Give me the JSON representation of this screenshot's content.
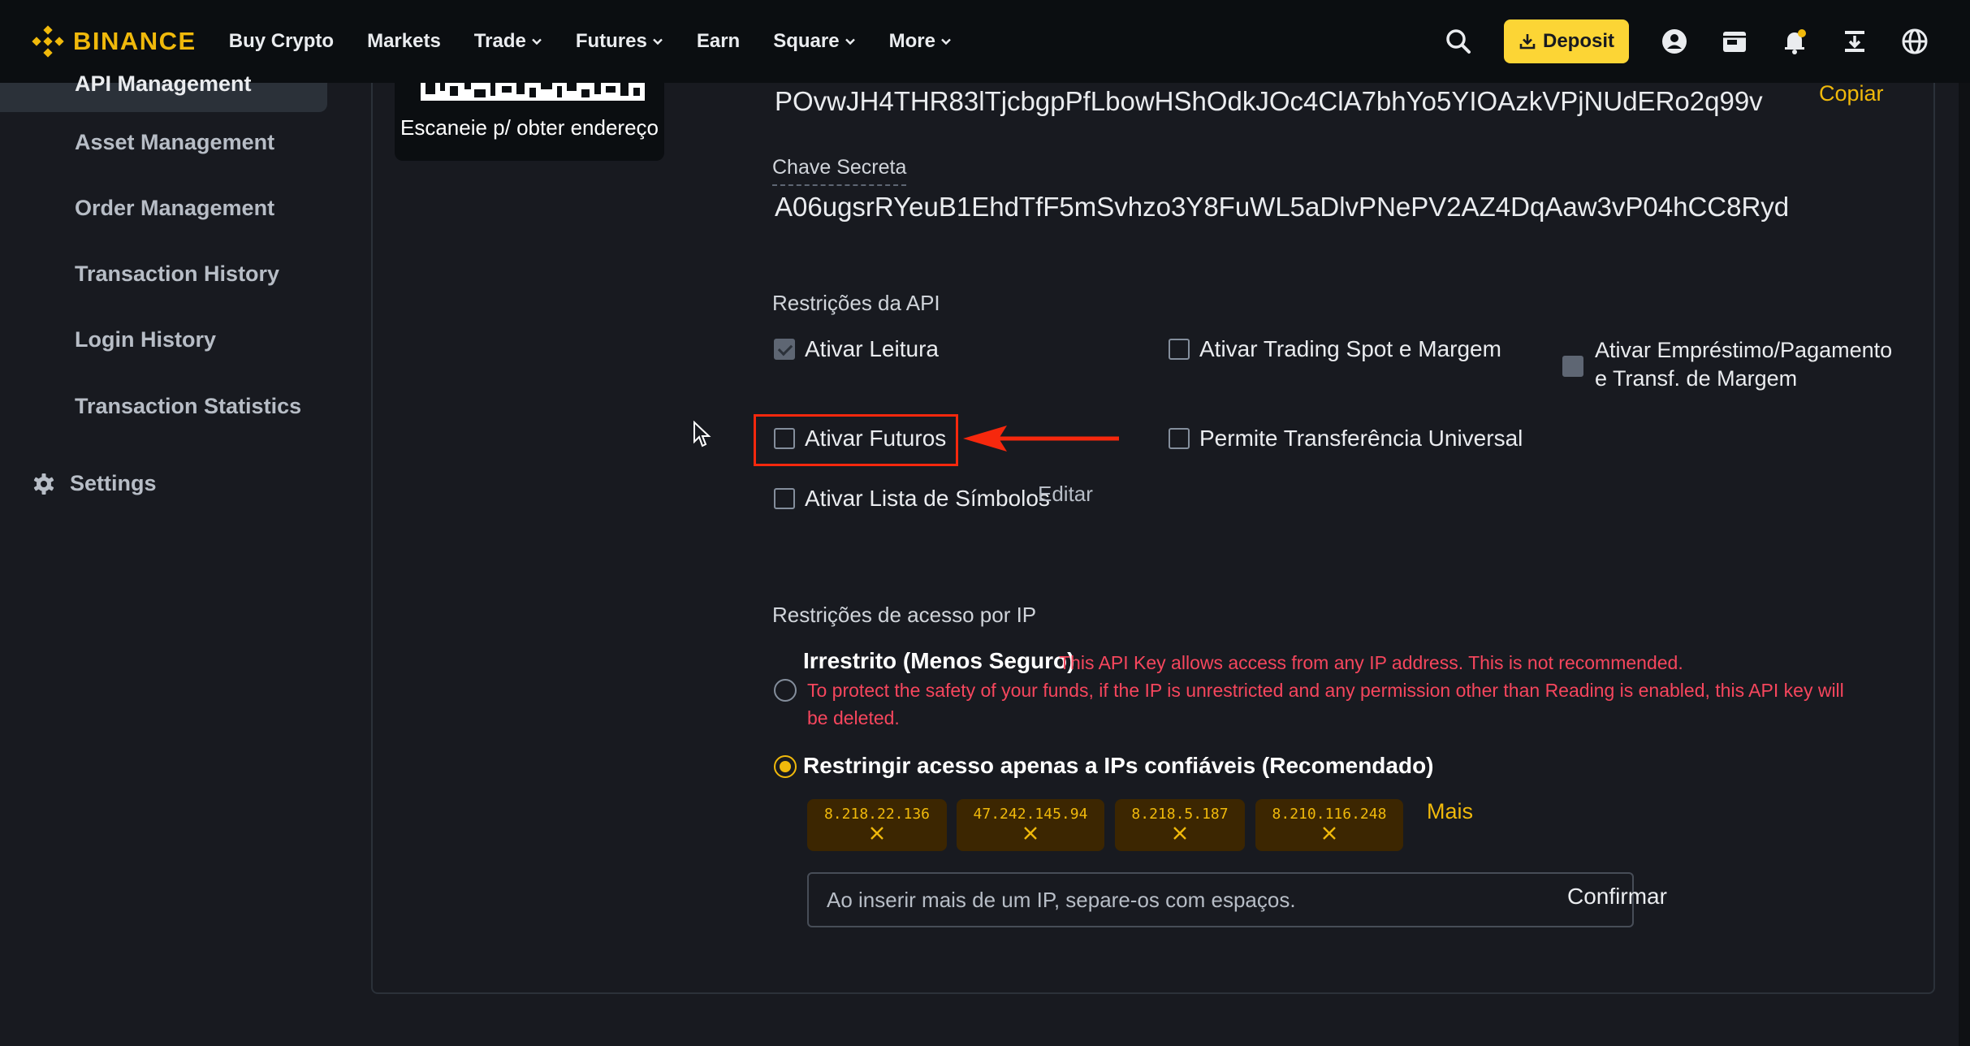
{
  "brand": {
    "name": "BINANCE",
    "accent": "#F0B90B"
  },
  "nav": {
    "items": [
      {
        "label": "Buy Crypto",
        "has_dropdown": false
      },
      {
        "label": "Markets",
        "has_dropdown": false
      },
      {
        "label": "Trade",
        "has_dropdown": true
      },
      {
        "label": "Futures",
        "has_dropdown": true
      },
      {
        "label": "Earn",
        "has_dropdown": false
      },
      {
        "label": "Square",
        "has_dropdown": true
      },
      {
        "label": "More",
        "has_dropdown": true
      }
    ],
    "deposit_label": "Deposit",
    "icons": [
      "search-icon",
      "profile-icon",
      "wallet-icon",
      "bell-icon",
      "download-icon",
      "globe-icon"
    ]
  },
  "sidebar": {
    "active_item": "API Management",
    "items": [
      "Asset Management",
      "Order Management",
      "Transaction History",
      "Login History",
      "Transaction Statistics"
    ],
    "settings_label": "Settings"
  },
  "qr": {
    "caption": "Escaneie p/ obter endereço"
  },
  "api": {
    "key": "POvwJH4THR83lTjcbgpPfLbowHShOdkJOc4ClA7bhYo5YIOAzkVPjNUdERo2q99v",
    "copy_label": "Copiar",
    "secret_label": "Chave Secreta",
    "secret": "A06ugsrRYeuB1EhdTfF5mSvhzo3Y8FuWL5aDlvPNePV2AZ4DqAaw3vP04hCC8Ryd"
  },
  "restrictions": {
    "title": "Restrições da API",
    "read": {
      "label": "Ativar Leitura",
      "checked": true
    },
    "spot": {
      "label": "Ativar Trading Spot e Margem",
      "checked": false
    },
    "margin_loan": {
      "line1": "Ativar Empréstimo/Pagamento",
      "line2": "e Transf. de Margem",
      "checked": false
    },
    "futures": {
      "label": "Ativar Futuros",
      "checked": false
    },
    "universal_transfer": {
      "label": "Permite Transferência Universal",
      "checked": false
    },
    "symbol_list": {
      "label": "Ativar Lista de Símbolos",
      "checked": false
    },
    "edit_label": "Editar"
  },
  "ip_restrictions": {
    "title": "Restrições de acesso por IP",
    "unrestricted": {
      "label": "Irrestrito (Menos Seguro)",
      "warning1": "This API Key allows access from any IP address. This is not recommended.",
      "warning2": "To protect the safety of your funds, if the IP is unrestricted and any permission other than Reading is enabled, this API key will",
      "warning3": "be deleted."
    },
    "trusted": {
      "label": "Restringir acesso apenas a IPs confiáveis (Recomendado)",
      "selected": true
    },
    "ips": [
      "8.218.22.136",
      "47.242.145.94",
      "8.218.5.187",
      "8.210.116.248"
    ],
    "more_label": "Mais",
    "input_placeholder": "Ao inserir mais de um IP, separe-os com espaços.",
    "confirm_label": "Confirmar"
  }
}
